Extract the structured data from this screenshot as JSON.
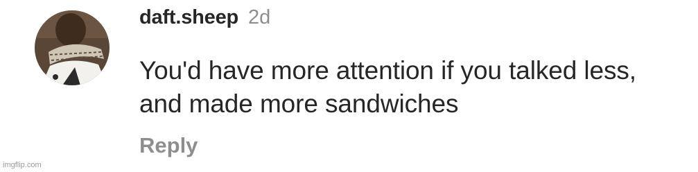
{
  "comment": {
    "username": "daft.sheep",
    "timestamp": "2d",
    "text": "You'd have more attention if you talked less, and made more sandwiches",
    "reply_label": "Reply",
    "avatar_icon": "user-avatar-photo"
  },
  "watermark": {
    "text": "imgflip.com"
  },
  "colors": {
    "text_primary": "#262626",
    "text_secondary": "#8e8e8e",
    "background": "#ffffff"
  }
}
